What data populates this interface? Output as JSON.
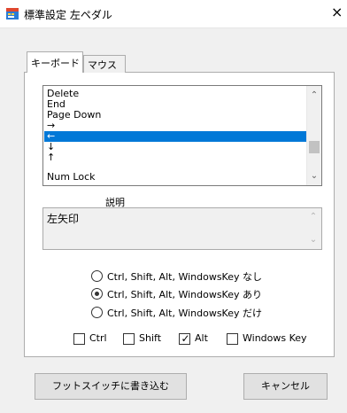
{
  "window": {
    "title": "標準設定 左ペダル",
    "close_icon": "×"
  },
  "tabs": [
    {
      "label": "キーボード",
      "active": true
    },
    {
      "label": "マウス",
      "active": false
    }
  ],
  "key_list": {
    "items": [
      "Delete",
      "End",
      "Page Down",
      "→",
      "←",
      "↓",
      "↑",
      "Num Lock"
    ],
    "selected_index": 4
  },
  "description": {
    "label": "説明",
    "text": "左矢印"
  },
  "modifier_options": [
    {
      "label": "Ctrl, Shift, Alt, WindowsKey なし",
      "selected": false
    },
    {
      "label": "Ctrl, Shift, Alt, WindowsKey あり",
      "selected": true
    },
    {
      "label": "Ctrl, Shift, Alt, WindowsKey だけ",
      "selected": false
    }
  ],
  "modifier_keys": [
    {
      "label": "Ctrl",
      "checked": false
    },
    {
      "label": "Shift",
      "checked": false
    },
    {
      "label": "Alt",
      "checked": true
    },
    {
      "label": "Windows Key",
      "checked": false
    }
  ],
  "buttons": {
    "write": "フットスイッチに書き込む",
    "cancel": "キャンセル"
  }
}
